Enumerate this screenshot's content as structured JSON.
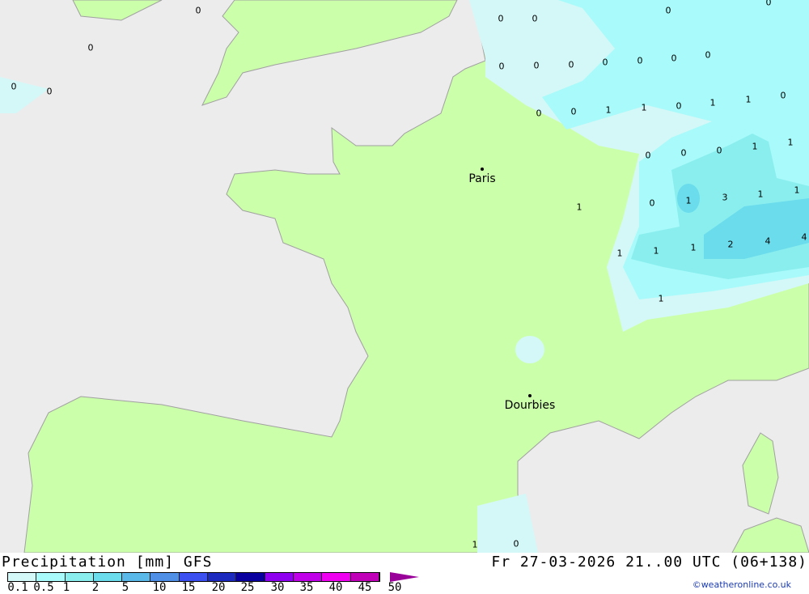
{
  "legend": {
    "title": "Precipitation [mm] GFS",
    "ticks": [
      "0.1",
      "0.5",
      "1",
      "2",
      "5",
      "10",
      "15",
      "20",
      "25",
      "30",
      "35",
      "40",
      "45",
      "50"
    ],
    "colors": [
      "#d4f8f8",
      "#a9fafa",
      "#8aeeee",
      "#6adcec",
      "#5ab9e8",
      "#4f90e6",
      "#3c4ff0",
      "#1c2ac0",
      "#0a00a0",
      "#9000f0",
      "#c000e8",
      "#f000f0",
      "#c000b8",
      "#990099"
    ]
  },
  "date_text": "Fr 27-03-2026 21..00 UTC (06+138)",
  "copyright": "©weatheronline.co.uk",
  "cities": [
    "Paris",
    "Dourbies"
  ],
  "values": [
    "0",
    "0",
    "0",
    "0",
    "0",
    "0",
    "0",
    "0",
    "0",
    "0",
    "0",
    "0",
    "0",
    "0",
    "0",
    "0",
    "1",
    "1",
    "0",
    "1",
    "1",
    "0",
    "0",
    "0",
    "0",
    "1",
    "1",
    "1",
    "0",
    "1",
    "3",
    "1",
    "1",
    "1",
    "1",
    "1",
    "2",
    "4",
    "4",
    "1",
    "1",
    "0",
    "0"
  ],
  "colors": {
    "sea": "#ececec",
    "land": "#ccffaa",
    "border": "#a0a0a0"
  }
}
